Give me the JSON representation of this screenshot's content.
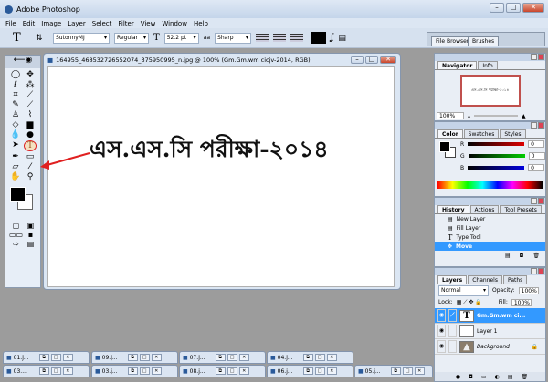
{
  "app": {
    "title": "Adobe Photoshop",
    "win_buttons": [
      "–",
      "□",
      "✕"
    ]
  },
  "menu": [
    "File",
    "Edit",
    "Image",
    "Layer",
    "Select",
    "Filter",
    "View",
    "Window",
    "Help"
  ],
  "options": {
    "tool_glyph": "T",
    "font_family": "SutonnyMJ",
    "font_style": "Regular",
    "font_size": "52.2 pt",
    "aa_label": "aa",
    "antialias": "Sharp",
    "text_color": "#000000"
  },
  "well_tabs": [
    "File Browser",
    "Brushes"
  ],
  "document": {
    "title": "164955_468532726552074_375950995_n.jpg @ 100% (Gm.Gm.wm cicjv-2014, RGB)",
    "text": "এস.এস.সি পরীক্ষা-২০১৪",
    "annotation_color": "#e02020"
  },
  "navigator": {
    "tabs": [
      "Navigator",
      "Info"
    ],
    "zoom": "100%"
  },
  "color": {
    "tabs": [
      "Color",
      "Swatches",
      "Styles"
    ],
    "channels": [
      {
        "label": "R",
        "value": "0"
      },
      {
        "label": "G",
        "value": "0"
      },
      {
        "label": "B",
        "value": "0"
      }
    ]
  },
  "history": {
    "tabs": [
      "History",
      "Actions",
      "Tool Presets"
    ],
    "items": [
      "New Layer",
      "Fill Layer",
      "Type Tool",
      "Move"
    ]
  },
  "layers": {
    "tabs": [
      "Layers",
      "Channels",
      "Paths"
    ],
    "blend": "Normal",
    "opacity_label": "Opacity:",
    "opacity": "100%",
    "lock_label": "Lock:",
    "fill_label": "Fill:",
    "fill": "100%",
    "items": [
      {
        "name": "Gm.Gm.wm ci...",
        "thumb": "T"
      },
      {
        "name": "Layer 1",
        "thumb": ""
      },
      {
        "name": "Background",
        "thumb": "▲"
      }
    ]
  },
  "minimized": {
    "row1": [
      "01.j...",
      "09.j...",
      "07.j...",
      "04.j..."
    ],
    "row2": [
      "03....",
      "03.j...",
      "08.j...",
      "06.j...",
      "05.j..."
    ]
  }
}
